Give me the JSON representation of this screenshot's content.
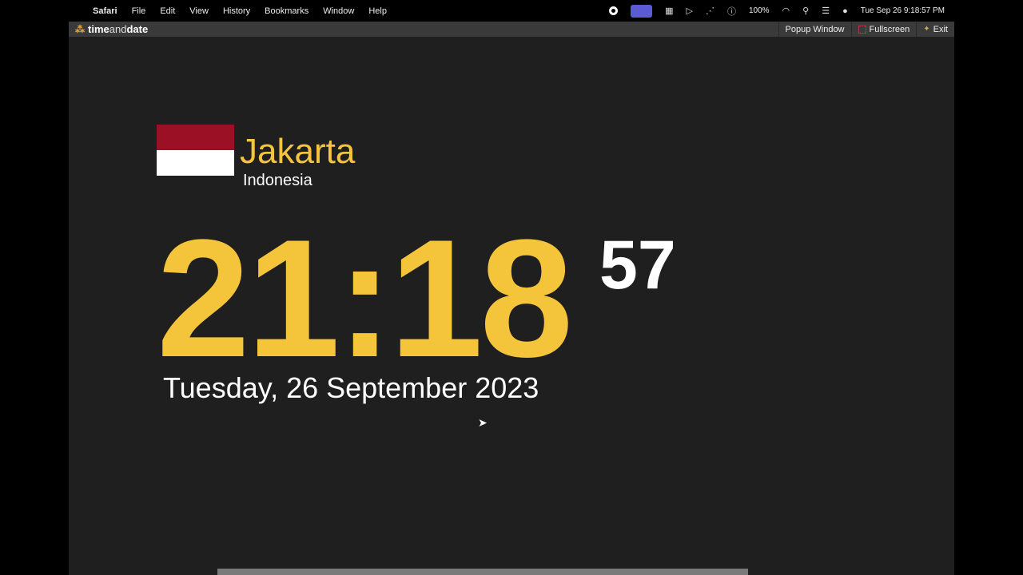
{
  "menubar": {
    "app": "Safari",
    "items": [
      "File",
      "Edit",
      "View",
      "History",
      "Bookmarks",
      "Window",
      "Help"
    ],
    "battery": "100%",
    "datetime": "Tue Sep 26  9:18:57 PM"
  },
  "toolbar": {
    "logo_time": "time",
    "logo_and": "and",
    "logo_date": "date",
    "popup": "Popup Window",
    "fullscreen": "Fullscreen",
    "exit": "Exit"
  },
  "clock": {
    "city": "Jakarta",
    "country": "Indonesia",
    "time": "21:18",
    "seconds": "57",
    "date": "Tuesday, 26 September 2023",
    "flag_colors": [
      "#9b1024",
      "#ffffff"
    ]
  }
}
